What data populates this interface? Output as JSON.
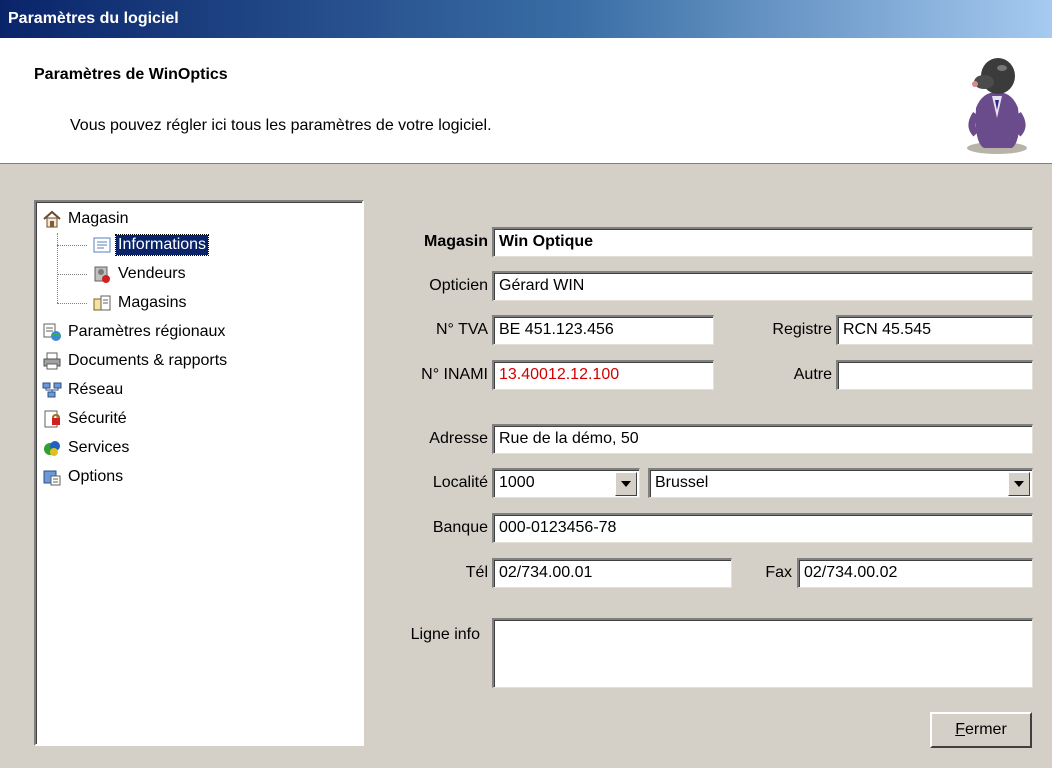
{
  "window": {
    "title": "Paramètres du logiciel"
  },
  "header": {
    "title": "Paramètres de WinOptics",
    "subtitle": "Vous pouvez régler ici tous les paramètres de votre logiciel."
  },
  "tree": {
    "items": [
      {
        "label": "Magasin",
        "icon": "home-icon"
      },
      {
        "label": "Informations",
        "icon": "info-card-icon",
        "selected": true
      },
      {
        "label": "Vendeurs",
        "icon": "users-icon"
      },
      {
        "label": "Magasins",
        "icon": "stores-icon"
      },
      {
        "label": "Paramètres régionaux",
        "icon": "regional-icon"
      },
      {
        "label": "Documents & rapports",
        "icon": "printer-icon"
      },
      {
        "label": "Réseau",
        "icon": "network-icon"
      },
      {
        "label": "Sécurité",
        "icon": "security-icon"
      },
      {
        "label": "Services",
        "icon": "services-icon"
      },
      {
        "label": "Options",
        "icon": "options-icon"
      }
    ]
  },
  "form": {
    "magasin": {
      "label": "Magasin",
      "value": "Win Optique"
    },
    "opticien": {
      "label": "Opticien",
      "value": "Gérard WIN"
    },
    "tva": {
      "label": "N° TVA",
      "value": "BE 451.123.456"
    },
    "registre": {
      "label": "Registre",
      "value": "RCN 45.545"
    },
    "inami": {
      "label": "N° INAMI",
      "value": "13.40012.12.100"
    },
    "autre": {
      "label": "Autre",
      "value": ""
    },
    "adresse": {
      "label": "Adresse",
      "value": "Rue de la démo, 50"
    },
    "localite": {
      "label": "Localité",
      "code": "1000",
      "city": "Brussel"
    },
    "banque": {
      "label": "Banque",
      "value": "000-0123456-78"
    },
    "tel": {
      "label": "Tél",
      "value": "02/734.00.01"
    },
    "fax": {
      "label": "Fax",
      "value": "02/734.00.02"
    },
    "ligne_info": {
      "label": "Ligne info",
      "value": ""
    }
  },
  "buttons": {
    "close_first": "F",
    "close_rest": "ermer"
  },
  "colors": {
    "inami_text": "#d40000",
    "selection": "#0a246a"
  }
}
